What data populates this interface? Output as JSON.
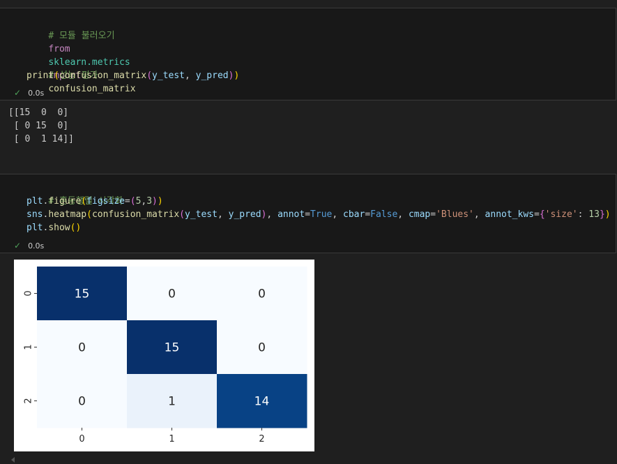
{
  "cell1": {
    "comment1": "# 모듈 불러오기",
    "line2": {
      "kw_from": "from",
      "module": "sklearn.metrics",
      "kw_import": "import",
      "name": "confusion_matrix"
    },
    "comment2": "# 성능 평가",
    "line4": {
      "print": "print",
      "open1": "(",
      "fn": "confusion_matrix",
      "open2": "(",
      "arg1": "y_test",
      "comma": ", ",
      "arg2": "y_pred",
      "close2": ")",
      "close1": ")"
    },
    "status": {
      "check": "✓",
      "time": "0.0s"
    }
  },
  "output1": {
    "text": "[[15  0  0]\n [ 0 15  0]\n [ 0  1 14]]"
  },
  "cell2": {
    "comment1": "# 혼동행렬 시각화",
    "line2": {
      "obj": "plt",
      "dot": ".",
      "fn": "figure",
      "open": "(",
      "kw": "figsize",
      "eq": "=",
      "open2": "(",
      "n1": "5",
      "comma": ",",
      "n2": "3",
      "close2": ")",
      "close": ")"
    },
    "line3": {
      "obj": "sns",
      "dot": ".",
      "fn": "heatmap",
      "open1": "(",
      "fn2": "confusion_matrix",
      "open2": "(",
      "arg1": "y_test",
      "comma1": ", ",
      "arg2": "y_pred",
      "close2": ")",
      "comma2": ", ",
      "k_annot": "annot",
      "eq": "=",
      "v_annot": "True",
      "comma3": ", ",
      "k_cbar": "cbar",
      "v_cbar": "False",
      "comma4": ", ",
      "k_cmap": "cmap",
      "v_cmap": "'Blues'",
      "comma5": ", ",
      "k_kws": "annot_kws",
      "brace_open": "{",
      "s_key": "'size'",
      "colon": ": ",
      "n_size": "13",
      "brace_close": "}",
      "close1": ")"
    },
    "line4": {
      "obj": "plt",
      "dot": ".",
      "fn": "show",
      "parens": "()"
    },
    "status": {
      "check": "✓",
      "time": "0.0s"
    }
  },
  "chart_data": {
    "type": "heatmap",
    "cmap": "Blues",
    "colorbar": false,
    "x_ticks": [
      "0",
      "1",
      "2"
    ],
    "y_ticks": [
      "0",
      "1",
      "2"
    ],
    "matrix": [
      [
        15,
        0,
        0
      ],
      [
        0,
        15,
        0
      ],
      [
        0,
        1,
        14
      ]
    ],
    "colors": {
      "max": "#08306b",
      "high": "#08468a",
      "low": "#e7f0fa",
      "min": "#f7fbff"
    }
  }
}
